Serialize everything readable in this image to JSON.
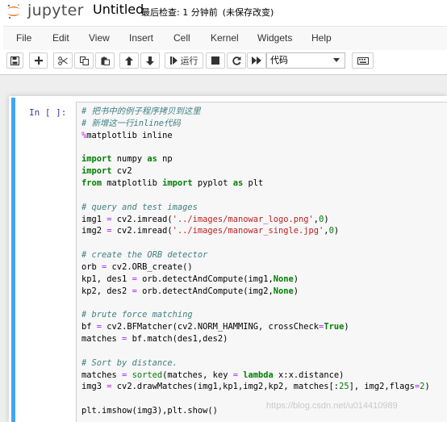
{
  "header": {
    "logo_text": "jupyter",
    "notebook_title": "Untitled",
    "checkpoint_label": "最后检查: 1 分钟前",
    "save_status": "(未保存改变)"
  },
  "menubar": {
    "items": [
      "File",
      "Edit",
      "View",
      "Insert",
      "Cell",
      "Kernel",
      "Widgets",
      "Help"
    ]
  },
  "toolbar": {
    "save_icon": "save-icon",
    "add_icon": "plus-icon",
    "cut_icon": "scissors-icon",
    "copy_icon": "copy-icon",
    "paste_icon": "paste-icon",
    "move_up_icon": "arrow-up-icon",
    "move_down_icon": "arrow-down-icon",
    "run_label": "运行",
    "interrupt_icon": "stop-icon",
    "restart_icon": "restart-icon",
    "run_all_icon": "fast-forward-icon",
    "cell_type_selected": "代码",
    "keyboard_icon": "keyboard-icon"
  },
  "cell": {
    "prompt": "In  [  ]:",
    "lines": [
      [
        {
          "t": "# 把书中的例子程序拷贝到这里",
          "c": "cm-comment"
        }
      ],
      [
        {
          "t": "# 新增这一行inline代码",
          "c": "cm-comment"
        }
      ],
      [
        {
          "t": "%",
          "c": "cm-magic"
        },
        {
          "t": "matplotlib inline",
          "c": ""
        }
      ],
      [],
      [
        {
          "t": "import",
          "c": "cm-keyword"
        },
        {
          "t": " numpy ",
          "c": ""
        },
        {
          "t": "as",
          "c": "cm-keyword"
        },
        {
          "t": " np",
          "c": ""
        }
      ],
      [
        {
          "t": "import",
          "c": "cm-keyword"
        },
        {
          "t": " cv2",
          "c": ""
        }
      ],
      [
        {
          "t": "from",
          "c": "cm-keyword"
        },
        {
          "t": " matplotlib ",
          "c": ""
        },
        {
          "t": "import",
          "c": "cm-keyword"
        },
        {
          "t": " pyplot ",
          "c": ""
        },
        {
          "t": "as",
          "c": "cm-keyword"
        },
        {
          "t": " plt",
          "c": ""
        }
      ],
      [],
      [
        {
          "t": "# query and test images",
          "c": "cm-comment"
        }
      ],
      [
        {
          "t": "img1 ",
          "c": ""
        },
        {
          "t": "=",
          "c": "cm-magic"
        },
        {
          "t": " cv2.imread(",
          "c": ""
        },
        {
          "t": "'../images/manowar_logo.png'",
          "c": "cm-string"
        },
        {
          "t": ",",
          "c": ""
        },
        {
          "t": "0",
          "c": "cm-number"
        },
        {
          "t": ")",
          "c": ""
        }
      ],
      [
        {
          "t": "img2 ",
          "c": ""
        },
        {
          "t": "=",
          "c": "cm-magic"
        },
        {
          "t": " cv2.imread(",
          "c": ""
        },
        {
          "t": "'../images/manowar_single.jpg'",
          "c": "cm-string"
        },
        {
          "t": ",",
          "c": ""
        },
        {
          "t": "0",
          "c": "cm-number"
        },
        {
          "t": ")",
          "c": ""
        }
      ],
      [],
      [
        {
          "t": "# create the ORB detector",
          "c": "cm-comment"
        }
      ],
      [
        {
          "t": "orb ",
          "c": ""
        },
        {
          "t": "=",
          "c": "cm-magic"
        },
        {
          "t": " cv2.ORB_create()",
          "c": ""
        }
      ],
      [
        {
          "t": "kp1, des1 ",
          "c": ""
        },
        {
          "t": "=",
          "c": "cm-magic"
        },
        {
          "t": " orb.detectAndCompute(img1,",
          "c": ""
        },
        {
          "t": "None",
          "c": "cm-kw"
        },
        {
          "t": ")",
          "c": ""
        }
      ],
      [
        {
          "t": "kp2, des2 ",
          "c": ""
        },
        {
          "t": "=",
          "c": "cm-magic"
        },
        {
          "t": " orb.detectAndCompute(img2,",
          "c": ""
        },
        {
          "t": "None",
          "c": "cm-kw"
        },
        {
          "t": ")",
          "c": ""
        }
      ],
      [],
      [
        {
          "t": "# brute force matching",
          "c": "cm-comment"
        }
      ],
      [
        {
          "t": "bf ",
          "c": ""
        },
        {
          "t": "=",
          "c": "cm-magic"
        },
        {
          "t": " cv2.BFMatcher(cv2.NORM_HAMMING, crossCheck",
          "c": ""
        },
        {
          "t": "=",
          "c": "cm-magic"
        },
        {
          "t": "True",
          "c": "cm-kw"
        },
        {
          "t": ")",
          "c": ""
        }
      ],
      [
        {
          "t": "matches ",
          "c": ""
        },
        {
          "t": "=",
          "c": "cm-magic"
        },
        {
          "t": " bf.match(des1,des2)",
          "c": ""
        }
      ],
      [],
      [
        {
          "t": "# Sort by distance.",
          "c": "cm-comment"
        }
      ],
      [
        {
          "t": "matches ",
          "c": ""
        },
        {
          "t": "=",
          "c": "cm-magic"
        },
        {
          "t": " ",
          "c": ""
        },
        {
          "t": "sorted",
          "c": "cm-builtin"
        },
        {
          "t": "(matches, key ",
          "c": ""
        },
        {
          "t": "=",
          "c": "cm-magic"
        },
        {
          "t": " ",
          "c": ""
        },
        {
          "t": "lambda",
          "c": "cm-keyword"
        },
        {
          "t": " x:x.distance)",
          "c": ""
        }
      ],
      [
        {
          "t": "img3 ",
          "c": ""
        },
        {
          "t": "=",
          "c": "cm-magic"
        },
        {
          "t": " cv2.drawMatches(img1,kp1,img2,kp2, matches[:",
          "c": ""
        },
        {
          "t": "25",
          "c": "cm-number"
        },
        {
          "t": "], img2,flags",
          "c": ""
        },
        {
          "t": "=",
          "c": "cm-magic"
        },
        {
          "t": "2",
          "c": "cm-number"
        },
        {
          "t": ")",
          "c": ""
        }
      ],
      [],
      [
        {
          "t": "plt.imshow(img3),plt.show()",
          "c": ""
        }
      ]
    ]
  },
  "watermark": "https://blog.csdn.net/u014410989",
  "colors": {
    "cell_border": "#42a5f5",
    "prompt": "#303f9f",
    "logo_orange": "#f37726"
  }
}
